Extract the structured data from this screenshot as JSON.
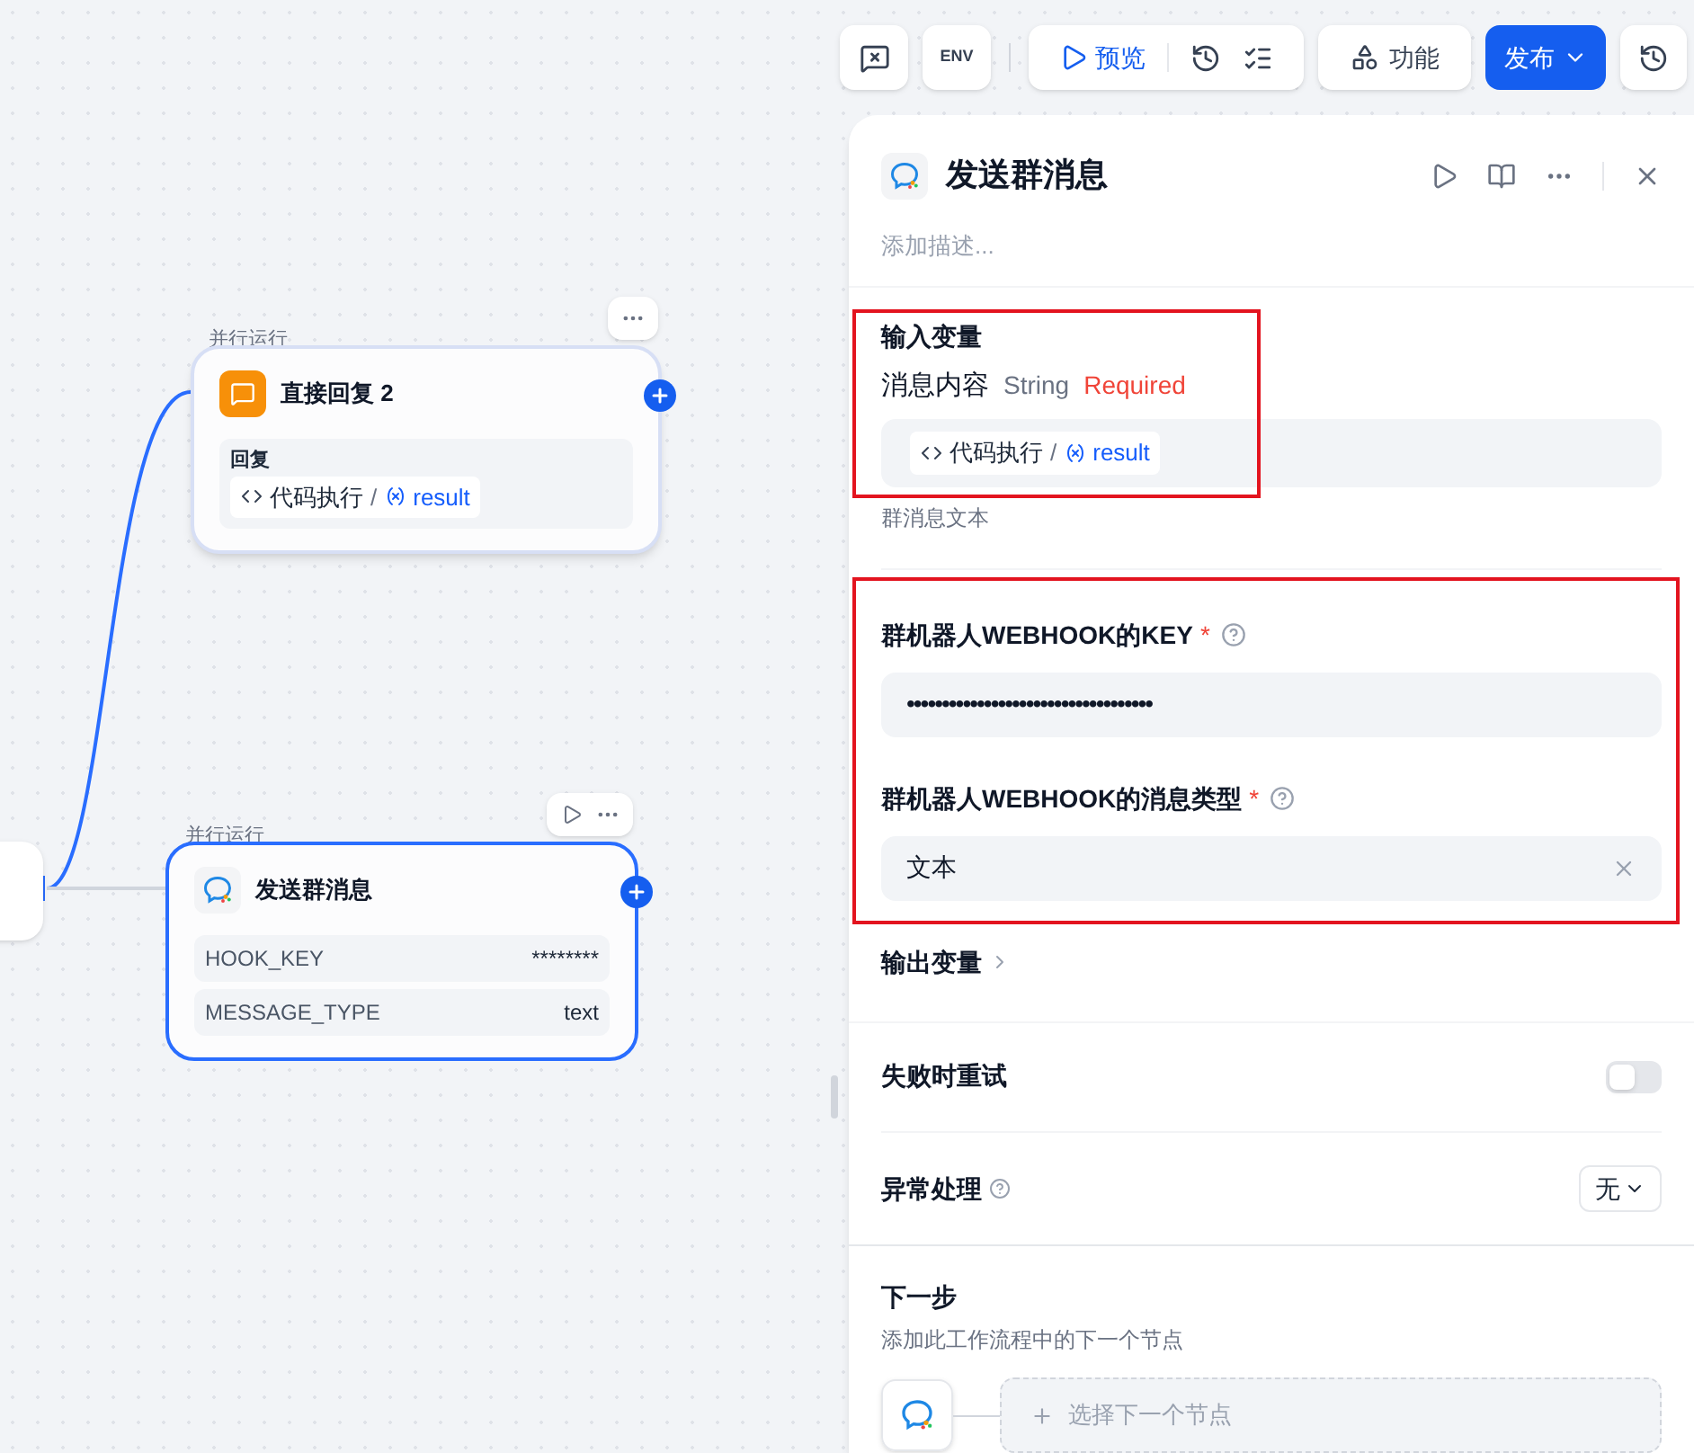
{
  "toolbar": {
    "preview_label": "预览",
    "features_label": "功能",
    "publish_label": "发布",
    "env_label": "ENV"
  },
  "canvas": {
    "nodes": [
      {
        "kind": "reply",
        "tag": "并行运行",
        "title": "直接回复 2",
        "selected": false,
        "section_label": "回复",
        "ref_node": "代码执行",
        "ref_separator": "/",
        "ref_var": "result"
      },
      {
        "kind": "message",
        "tag": "并行运行",
        "title": "发送群消息",
        "selected": true,
        "params": [
          {
            "name": "HOOK_KEY",
            "value": "********"
          },
          {
            "name": "MESSAGE_TYPE",
            "value": "text"
          }
        ]
      }
    ]
  },
  "panel": {
    "title": "发送群消息",
    "description_placeholder": "添加描述...",
    "input_section": {
      "title": "输入变量",
      "var_name": "消息内容",
      "var_type": "String",
      "var_required": "Required",
      "ref_node": "代码执行",
      "ref_separator": "/",
      "ref_var": "result",
      "hint": "群消息文本"
    },
    "fields": [
      {
        "label": "群机器人WEBHOOK的KEY",
        "required": "*",
        "value": "•••••••••••••••••••••••••••••••••••",
        "kind": "password"
      },
      {
        "label": "群机器人WEBHOOK的消息类型",
        "required": "*",
        "value": "文本",
        "kind": "select"
      }
    ],
    "output_section": {
      "title": "输出变量",
      "expanded": false
    },
    "retry": {
      "label": "失败时重试",
      "on": false
    },
    "error_handling": {
      "label": "异常处理",
      "value": "无"
    },
    "next_step": {
      "title": "下一步",
      "description": "添加此工作流程中的下一个节点",
      "placeholder": "选择下一个节点"
    }
  }
}
